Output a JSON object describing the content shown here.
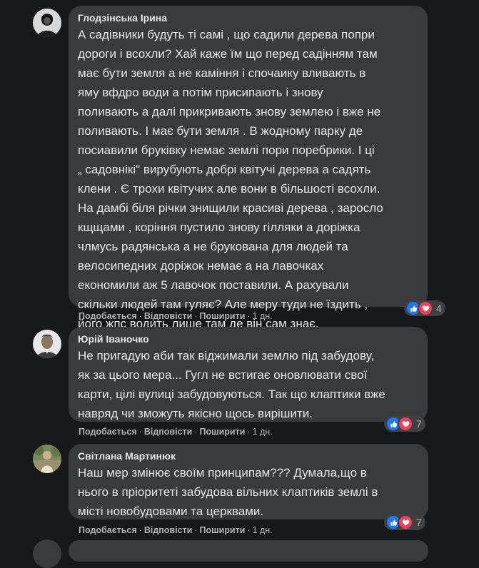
{
  "comments": [
    {
      "author": "Глодзінська Ірина",
      "avatar_icon": "user-avatar-photo",
      "text": "А садівники будуть ті самі , що садили дерева попри\nдороги і всохли? Хай каже їм що перед садінням там\nмає бути земля а не каміння і спочаику вливають в\nяму вфдро води а потім присипають і знову\nполивають а далі прикривають знову землею і вже не\nполивають. І має бути земля . В жодному парку де\nпосиавили бруківку немає землі пори поребрики. І ці\n„ садовнікі\" вирубують добрі квітучі дерева а садять\nклени . Є трохи квітучих але вони в більшості всохли.\nНа дамбі біля річки знищили красиві дерева , заросло\nкщщами , коріння пустило знову гілляки а доріжка\nчлмусь радянська а не брукована для людей та\nвелосипедних доріжок немає а на лавочках\nекономили аж 5 лавочок поставили. А рахували\nскільки людей там гуляє? Але меру туди не їздить ,\nйого жпс водить лише там де він сам знає.",
      "like_label": "Подобається",
      "reply_label": "Відповісти",
      "share_label": "Поширити",
      "time": "1 дн.",
      "reaction_count": "4"
    },
    {
      "author": "Юрій Іваночко",
      "avatar_icon": "user-avatar-photo",
      "text": "Не пригадую аби так віджимали землю під забудову,\nяк за цього мера... Гугл не встигає оновлювати свої\nкарти, цілі вулиці забудовуються. Так що клаптики вже\nнавряд чи зможуть якісно щось вирішити.",
      "like_label": "Подобається",
      "reply_label": "Відповісти",
      "share_label": "Поширити",
      "time": "1 дн.",
      "reaction_count": "7"
    },
    {
      "author": "Світлана Мартинюк",
      "avatar_icon": "user-avatar-photo",
      "text": "Наш мер змінює своїм принципам??? Думала,що в\nнього в пріоритеті забудова вільних клаптиків землі в\nмісті новобудовами та церквами.",
      "like_label": "Подобається",
      "reply_label": "Відповісти",
      "share_label": "Поширити",
      "time": "1 дн.",
      "reaction_count": "7"
    }
  ],
  "separator": "·",
  "colors": {
    "background": "#18191a",
    "bubble": "#3a3b3c",
    "text": "#e4e6eb",
    "secondary_text": "#b0b3b8",
    "like": "#2078f4",
    "love": "#f33e58"
  },
  "reaction_icons": [
    "like-icon",
    "love-icon"
  ]
}
